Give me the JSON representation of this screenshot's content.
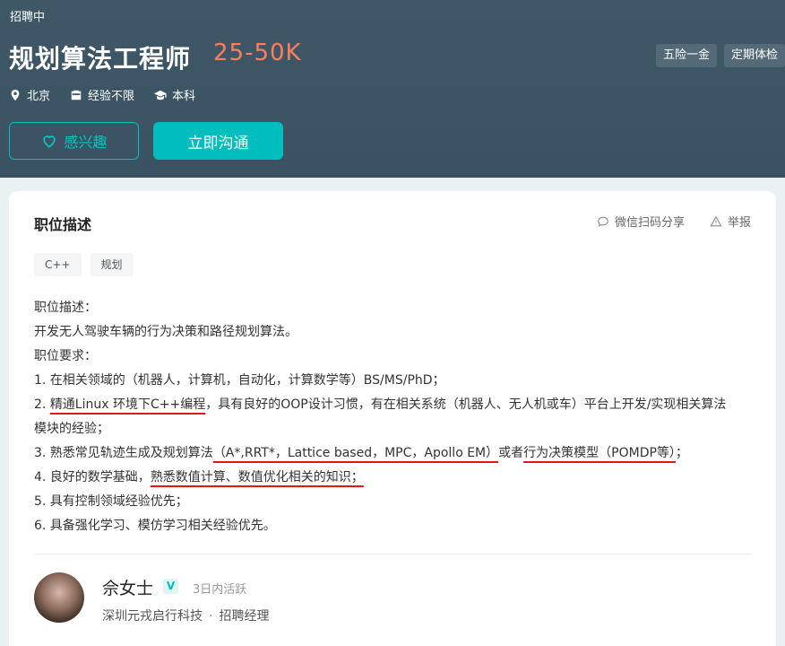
{
  "header": {
    "status": "招聘中",
    "title": "规划算法工程师",
    "salary": "25-50K",
    "benefits": [
      "五险一金",
      "定期体检"
    ],
    "location": "北京",
    "experience": "经验不限",
    "education": "本科",
    "interest_label": "感兴趣",
    "chat_label": "立即沟通"
  },
  "card": {
    "title": "职位描述",
    "share_label": "微信扫码分享",
    "report_label": "举报",
    "skills": [
      "C++",
      "规划"
    ],
    "desc": {
      "l1": "职位描述：",
      "l2": "开发无人驾驶车辆的行为决策和路径规划算法。",
      "l3": "职位要求：",
      "l4": "1. 在相关领域的（机器人，计算机，自动化，计算数学等）BS/MS/PhD；",
      "l5a": "2. ",
      "l5b": "精通Linux 环境下C++编程",
      "l5c": "，具有良好的OOP设计习惯，有在相关系统（机器人、无人机或车）平台上开发/实现相关算法",
      "l6": "模块的经验；",
      "l7a": "3. 熟悉常见轨迹生成及规划算法",
      "l7b": "（A*,RRT*，Lattice based，MPC，Apollo EM）",
      "l7c": "或者",
      "l7d": "行为决策模型（POMDP等）",
      "l7e": "；",
      "l8a": "4. 良好的数学基础，",
      "l8b": "熟悉数值计算、数值优化相关的知识；",
      "l9": "5. 具有控制领域经验优先；",
      "l10": "6. 具备强化学习、模仿学习相关经验优先。"
    }
  },
  "recruiter": {
    "name": "佘女士",
    "badge": "V",
    "active": "3日内活跃",
    "company": "深圳元戎启行科技",
    "separator": "·",
    "role": "招聘经理"
  },
  "colors": {
    "header_bg": "#3f5868",
    "accent": "#00bebd",
    "salary": "#ff7f5c",
    "underline": "#e01818"
  }
}
